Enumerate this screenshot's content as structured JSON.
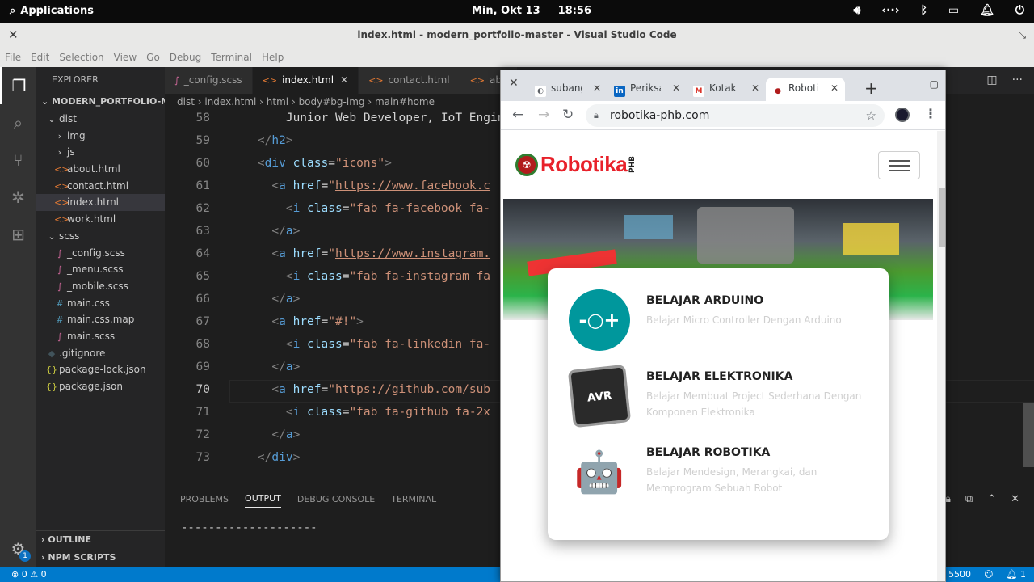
{
  "topbar": {
    "apps_label": "Applications",
    "date": "Min, Okt 13",
    "time": "18:56"
  },
  "window": {
    "title": "index.html - modern_portfolio-master - Visual Studio Code"
  },
  "menu": [
    "File",
    "Edit",
    "Selection",
    "View",
    "Go",
    "Debug",
    "Terminal",
    "Help"
  ],
  "explorer": {
    "header": "EXPLORER",
    "root": "MODERN_PORTFOLIO-M...",
    "items": [
      {
        "label": "dist",
        "icon": "⌄",
        "indent": 1,
        "type": "folder"
      },
      {
        "label": "img",
        "icon": "›",
        "indent": 2,
        "type": "folder"
      },
      {
        "label": "js",
        "icon": "›",
        "indent": 2,
        "type": "folder"
      },
      {
        "label": "about.html",
        "icon": "<>",
        "indent": 2,
        "type": "html"
      },
      {
        "label": "contact.html",
        "icon": "<>",
        "indent": 2,
        "type": "html"
      },
      {
        "label": "index.html",
        "icon": "<>",
        "indent": 2,
        "type": "html",
        "selected": true
      },
      {
        "label": "work.html",
        "icon": "<>",
        "indent": 2,
        "type": "html"
      },
      {
        "label": "scss",
        "icon": "⌄",
        "indent": 1,
        "type": "folder"
      },
      {
        "label": "_config.scss",
        "icon": "∫",
        "indent": 2,
        "type": "scss"
      },
      {
        "label": "_menu.scss",
        "icon": "∫",
        "indent": 2,
        "type": "scss"
      },
      {
        "label": "_mobile.scss",
        "icon": "∫",
        "indent": 2,
        "type": "scss"
      },
      {
        "label": "main.css",
        "icon": "#",
        "indent": 2,
        "type": "css"
      },
      {
        "label": "main.css.map",
        "icon": "#",
        "indent": 2,
        "type": "css"
      },
      {
        "label": "main.scss",
        "icon": "∫",
        "indent": 2,
        "type": "scss"
      },
      {
        "label": ".gitignore",
        "icon": "◆",
        "indent": 1,
        "type": "git"
      },
      {
        "label": "package-lock.json",
        "icon": "{}",
        "indent": 1,
        "type": "json"
      },
      {
        "label": "package.json",
        "icon": "{}",
        "indent": 1,
        "type": "json"
      }
    ],
    "outline": "OUTLINE",
    "npm": "NPM SCRIPTS"
  },
  "tabs": [
    {
      "label": "_config.scss",
      "kind": "scss",
      "active": false
    },
    {
      "label": "index.html",
      "kind": "html",
      "active": true
    },
    {
      "label": "contact.html",
      "kind": "html",
      "active": false
    },
    {
      "label": "abc",
      "kind": "html",
      "active": false
    }
  ],
  "breadcrumb": [
    "dist",
    "index.html",
    "html",
    "body#bg-img",
    "main#home"
  ],
  "code": {
    "lines": [
      {
        "n": "58",
        "html": "  Junior Web Developer, IoT Engin"
      },
      {
        "n": "59",
        "html": "<span class=\"g\">&lt;/</span><span class=\"t\">h2</span><span class=\"g\">&gt;</span>"
      },
      {
        "n": "60",
        "html": "<span class=\"g\">&lt;</span><span class=\"t\">div</span> <span class=\"a\">class</span>=<span class=\"s\">\"icons\"</span><span class=\"g\">&gt;</span>"
      },
      {
        "n": "61",
        "html": "  <span class=\"g\">&lt;</span><span class=\"t\">a</span> <span class=\"a\">href</span>=<span class=\"s\">\"<u>https://www.facebook.c</u></span>"
      },
      {
        "n": "62",
        "html": "    <span class=\"g\">&lt;</span><span class=\"t\">i</span> <span class=\"a\">class</span>=<span class=\"s\">\"fab fa-facebook fa-</span>"
      },
      {
        "n": "63",
        "html": "  <span class=\"g\">&lt;/</span><span class=\"t\">a</span><span class=\"g\">&gt;</span>"
      },
      {
        "n": "64",
        "html": "  <span class=\"g\">&lt;</span><span class=\"t\">a</span> <span class=\"a\">href</span>=<span class=\"s\">\"<u>https://www.instagram.</u></span>"
      },
      {
        "n": "65",
        "html": "    <span class=\"g\">&lt;</span><span class=\"t\">i</span> <span class=\"a\">class</span>=<span class=\"s\">\"fab fa-instagram fa</span>"
      },
      {
        "n": "66",
        "html": "  <span class=\"g\">&lt;/</span><span class=\"t\">a</span><span class=\"g\">&gt;</span>"
      },
      {
        "n": "67",
        "html": "  <span class=\"g\">&lt;</span><span class=\"t\">a</span> <span class=\"a\">href</span>=<span class=\"s\">\"#!\"</span><span class=\"g\">&gt;</span>"
      },
      {
        "n": "68",
        "html": "    <span class=\"g\">&lt;</span><span class=\"t\">i</span> <span class=\"a\">class</span>=<span class=\"s\">\"fab fa-linkedin fa-</span>"
      },
      {
        "n": "69",
        "html": "  <span class=\"g\">&lt;/</span><span class=\"t\">a</span><span class=\"g\">&gt;</span>"
      },
      {
        "n": "70",
        "html": "  <span class=\"g\">&lt;</span><span class=\"t\">a</span> <span class=\"a\">href</span>=<span class=\"s\">\"<u>https://github.com/sub</u></span>"
      },
      {
        "n": "71",
        "html": "    <span class=\"g\">&lt;</span><span class=\"t\">i</span> <span class=\"a\">class</span>=<span class=\"s\">\"fab fa-github fa-2x</span>"
      },
      {
        "n": "72",
        "html": "  <span class=\"g\">&lt;/</span><span class=\"t\">a</span><span class=\"g\">&gt;</span>"
      },
      {
        "n": "73",
        "html": "<span class=\"g\">&lt;/</span><span class=\"t\">div</span><span class=\"g\">&gt;</span>"
      }
    ],
    "current_line": "70"
  },
  "panel": {
    "tabs": [
      "PROBLEMS",
      "OUTPUT",
      "DEBUG CONSOLE",
      "TERMINAL"
    ],
    "active": "OUTPUT",
    "output": "--------------------"
  },
  "status": {
    "errors": "0",
    "warnings": "0",
    "port": "5500",
    "notifications": "1"
  },
  "browser": {
    "tabs": [
      {
        "label": "subang",
        "fav": "globe",
        "fav_text": "◐"
      },
      {
        "label": "Periksa",
        "fav": "linkedin",
        "fav_text": "in"
      },
      {
        "label": "Kotak M",
        "fav": "gmail",
        "fav_text": "M"
      },
      {
        "label": "Robotik",
        "fav": "robotika",
        "fav_text": "●",
        "active": true
      }
    ],
    "url": "robotika-phb.com",
    "brand": "Robotika",
    "brand_sub": "PHB",
    "cards": [
      {
        "title": "BELAJAR ARDUINO",
        "desc": "Belajar Micro Controller Dengan Arduino",
        "icon": "arduino-icon",
        "glyph": "-○+"
      },
      {
        "title": "BELAJAR ELEKTRONIKA",
        "desc": "Belajar Membuat Project Sederhana Dengan Komponen Elektronika",
        "icon": "avr-chip-icon",
        "glyph": "AVR"
      },
      {
        "title": "BELAJAR ROBOTIKA",
        "desc": "Belajar Mendesign, Merangkai, dan Memprogram Sebuah Robot",
        "icon": "robot-icon",
        "glyph": "🤖"
      }
    ]
  }
}
